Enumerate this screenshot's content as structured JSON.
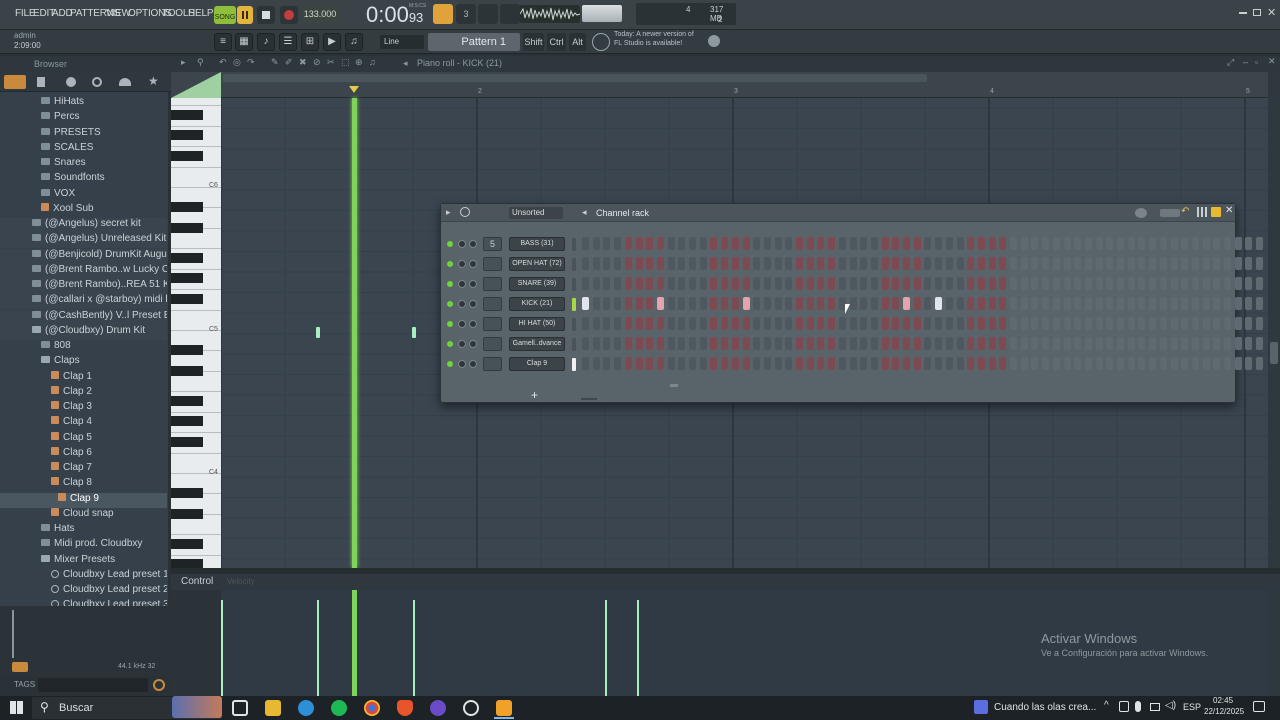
{
  "menu": [
    "FILE",
    "EDIT",
    "ADD",
    "PATTERNS",
    "VIEW",
    "OPTIONS",
    "TOOLS",
    "HELP"
  ],
  "song_toggle": "SONG",
  "tempo": "133.000",
  "time": {
    "main": "0:00",
    "sub": "93",
    "label": "M:S:CS"
  },
  "cpu": {
    "value1": "4",
    "memory": "317 MB",
    "value2": "2"
  },
  "hint": {
    "user": "admin",
    "time": "2:09:00"
  },
  "snap": "Line",
  "pattern": "Pattern 1",
  "keys": [
    "Shift",
    "Ctrl",
    "Alt"
  ],
  "news": {
    "line1": "Today:  A newer version of",
    "line2": "FL Studio is available!"
  },
  "browser": {
    "title": "Browser",
    "items": [
      {
        "label": "HiHats",
        "kind": "folder",
        "level": 2
      },
      {
        "label": "Percs",
        "kind": "folder",
        "level": 2
      },
      {
        "label": "PRESETS",
        "kind": "folder",
        "level": 2
      },
      {
        "label": "SCALES",
        "kind": "folder",
        "level": 2
      },
      {
        "label": "Snares",
        "kind": "folder",
        "level": 2
      },
      {
        "label": "Soundfonts",
        "kind": "folder",
        "level": 2
      },
      {
        "label": "VOX",
        "kind": "folder",
        "level": 2
      },
      {
        "label": "Xool Sub",
        "kind": "audio",
        "level": 2
      },
      {
        "label": "(@Angelus) secret kit",
        "kind": "pack",
        "level": 1
      },
      {
        "label": "(@Angelus) Unreleased Kit",
        "kind": "pack",
        "level": 1
      },
      {
        "label": "(@Benjicold) DrumKit August",
        "kind": "pack",
        "level": 1
      },
      {
        "label": "(@Brent Rambo..w Lucky Charms",
        "kind": "pack",
        "level": 1
      },
      {
        "label": "(@Brent Rambo)..REA 51 KIT",
        "kind": "pack",
        "level": 1
      },
      {
        "label": "(@callari x @starboy) midi kit",
        "kind": "pack",
        "level": 1
      },
      {
        "label": "(@CashBently) V..l Preset Bundle",
        "kind": "pack",
        "level": 1
      },
      {
        "label": "(@Cloudbxy) Drum Kit",
        "kind": "pack-open",
        "level": 1
      },
      {
        "label": "808",
        "kind": "folder",
        "level": 2
      },
      {
        "label": "Claps",
        "kind": "folder-open",
        "level": 2
      },
      {
        "label": "Clap 1",
        "kind": "audio",
        "level": 3
      },
      {
        "label": "Clap 2",
        "kind": "audio",
        "level": 3
      },
      {
        "label": "Clap 3",
        "kind": "audio",
        "level": 3
      },
      {
        "label": "Clap 4",
        "kind": "audio",
        "level": 3
      },
      {
        "label": "Clap 5",
        "kind": "audio",
        "level": 3
      },
      {
        "label": "Clap 6",
        "kind": "audio",
        "level": 3
      },
      {
        "label": "Clap 7",
        "kind": "audio",
        "level": 3
      },
      {
        "label": "Clap 8",
        "kind": "audio",
        "level": 3
      },
      {
        "label": "Clap 9",
        "kind": "audio-sel",
        "level": 3
      },
      {
        "label": "Cloud snap",
        "kind": "audio",
        "level": 3
      },
      {
        "label": "Hats",
        "kind": "folder",
        "level": 2
      },
      {
        "label": "Midi prod. Cloudbxy",
        "kind": "folder",
        "level": 2
      },
      {
        "label": "Mixer Presets",
        "kind": "folder-open",
        "level": 2
      },
      {
        "label": "Cloudbxy Lead preset 1",
        "kind": "preset",
        "level": 3
      },
      {
        "label": "Cloudbxy Lead preset 2",
        "kind": "preset",
        "level": 3
      },
      {
        "label": "Cloudbxy Lead preset 3",
        "kind": "preset",
        "level": 3
      }
    ],
    "samplerate": "44.1 kHz 32",
    "tags_label": "TAGS"
  },
  "piano_roll": {
    "title": "Piano roll - KICK (21)",
    "bars": [
      "2",
      "3",
      "4",
      "5"
    ],
    "key_labels": [
      "C6",
      "C5",
      "C4"
    ],
    "control_label": "Control",
    "control_sub": "Velocity"
  },
  "channel_rack": {
    "title": "Channel rack",
    "filter": "Unsorted",
    "mixer_track": "5",
    "channels": [
      {
        "name": "BASS (31)",
        "active": false
      },
      {
        "name": "OPEN HAT (72)",
        "active": false
      },
      {
        "name": "SNARE (39)",
        "active": false
      },
      {
        "name": "KICK (21)",
        "active": true
      },
      {
        "name": "HI HAT (50)",
        "active": false
      },
      {
        "name": "Gamell..dvance",
        "active": false
      },
      {
        "name": "Clap 9",
        "active": false
      }
    ],
    "kick_steps_on": [
      0,
      7,
      15,
      30,
      33
    ],
    "add_label": "+"
  },
  "watermark": {
    "title": "Activar Windows",
    "sub": "Ve a Configuración para activar Windows."
  },
  "taskbar": {
    "search": "Buscar",
    "notification": "Cuando las olas crea...",
    "lang": "ESP",
    "time": "02:45",
    "date": "22/12/2025"
  }
}
